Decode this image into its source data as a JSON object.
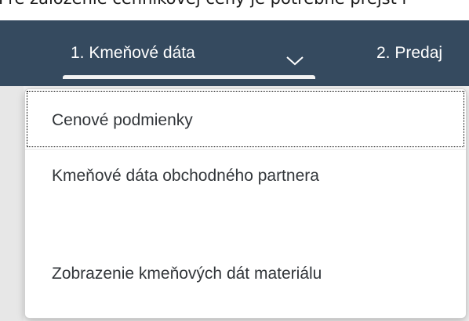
{
  "page": {
    "top_text": "Pre založenie cenníkovej ceny je potrebné prejsť r"
  },
  "nav": {
    "tabs": [
      {
        "label": "1. Kmeňové dáta",
        "active": true
      },
      {
        "label": "2. Predaj"
      }
    ]
  },
  "dropdown": {
    "items": [
      {
        "label": "Cenové podmienky",
        "focused": true
      },
      {
        "label": "Kmeňové dáta obchodného partnera"
      },
      {
        "label": "Zobrazenie kmeňových dát materiálu"
      }
    ]
  },
  "colors": {
    "shell_bar": "#354a5f",
    "tab_text": "#ffffff",
    "menu_text": "#32363a",
    "content_bg": "#efefef"
  },
  "icons": {
    "tab_dropdown": "chevron-down-icon"
  }
}
